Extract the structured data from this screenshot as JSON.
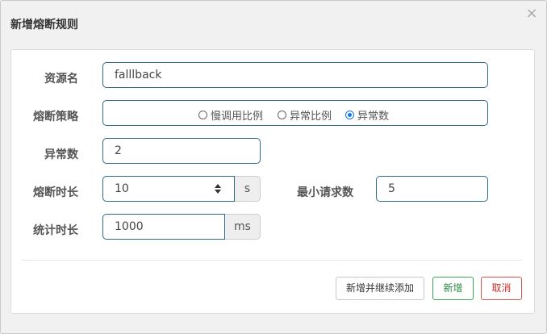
{
  "dialog": {
    "title": "新增熔断规则",
    "close_symbol": "×"
  },
  "form": {
    "resource": {
      "label": "资源名",
      "value": "falllback"
    },
    "strategy": {
      "label": "熔断策略",
      "options": [
        {
          "label": "慢调用比例",
          "checked": false
        },
        {
          "label": "异常比例",
          "checked": false
        },
        {
          "label": "异常数",
          "checked": true
        }
      ]
    },
    "exception_count": {
      "label": "异常数",
      "value": "2"
    },
    "break_duration": {
      "label": "熔断时长",
      "value": "10",
      "unit": "s"
    },
    "min_request": {
      "label": "最小请求数",
      "value": "5"
    },
    "stat_duration": {
      "label": "统计时长",
      "value": "1000",
      "unit": "ms"
    }
  },
  "footer": {
    "add_continue_label": "新增并继续添加",
    "add_label": "新增",
    "cancel_label": "取消"
  }
}
